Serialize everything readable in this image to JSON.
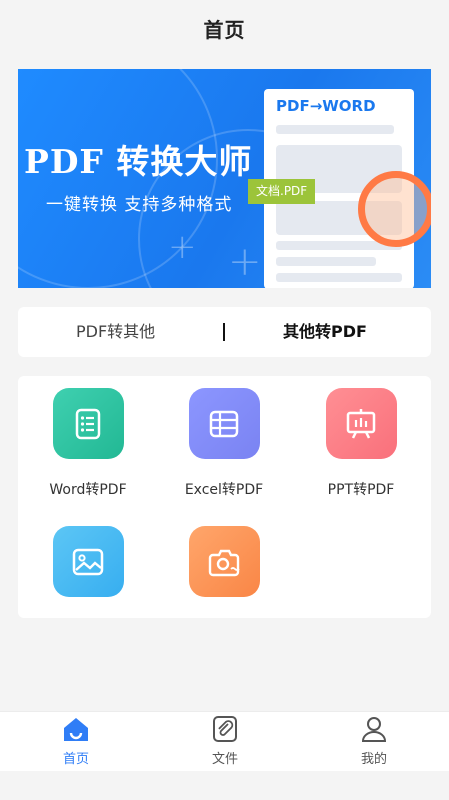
{
  "header": {
    "title": "首页"
  },
  "banner": {
    "title": "PDF 转换大师",
    "subtitle": "一键转换  支持多种格式",
    "doc_heading": "PDF→WORD",
    "doc_tag": "文档.PDF"
  },
  "switch": {
    "left_label": "PDF转其他",
    "right_label": "其他转PDF",
    "active": "right"
  },
  "tools": [
    {
      "label": "Word转PDF",
      "icon": "word-doc-icon",
      "color_from": "#3fd0b0",
      "color_to": "#22b894"
    },
    {
      "label": "Excel转PDF",
      "icon": "spreadsheet-icon",
      "color_from": "#8c96ff",
      "color_to": "#7a83f2"
    },
    {
      "label": "PPT转PDF",
      "icon": "presentation-icon",
      "color_from": "#ff8f94",
      "color_to": "#f9707b"
    },
    {
      "label": "",
      "icon": "image-icon",
      "color_from": "#5cc6f5",
      "color_to": "#37aef0"
    },
    {
      "label": "",
      "icon": "camera-icon",
      "color_from": "#ffa66b",
      "color_to": "#f98646"
    }
  ],
  "tabbar": {
    "items": [
      {
        "label": "首页",
        "icon": "home-icon",
        "active": true
      },
      {
        "label": "文件",
        "icon": "file-clip-icon",
        "active": false
      },
      {
        "label": "我的",
        "icon": "user-icon",
        "active": false
      }
    ],
    "active_color": "#2f7df6",
    "inactive_color": "#555555"
  }
}
